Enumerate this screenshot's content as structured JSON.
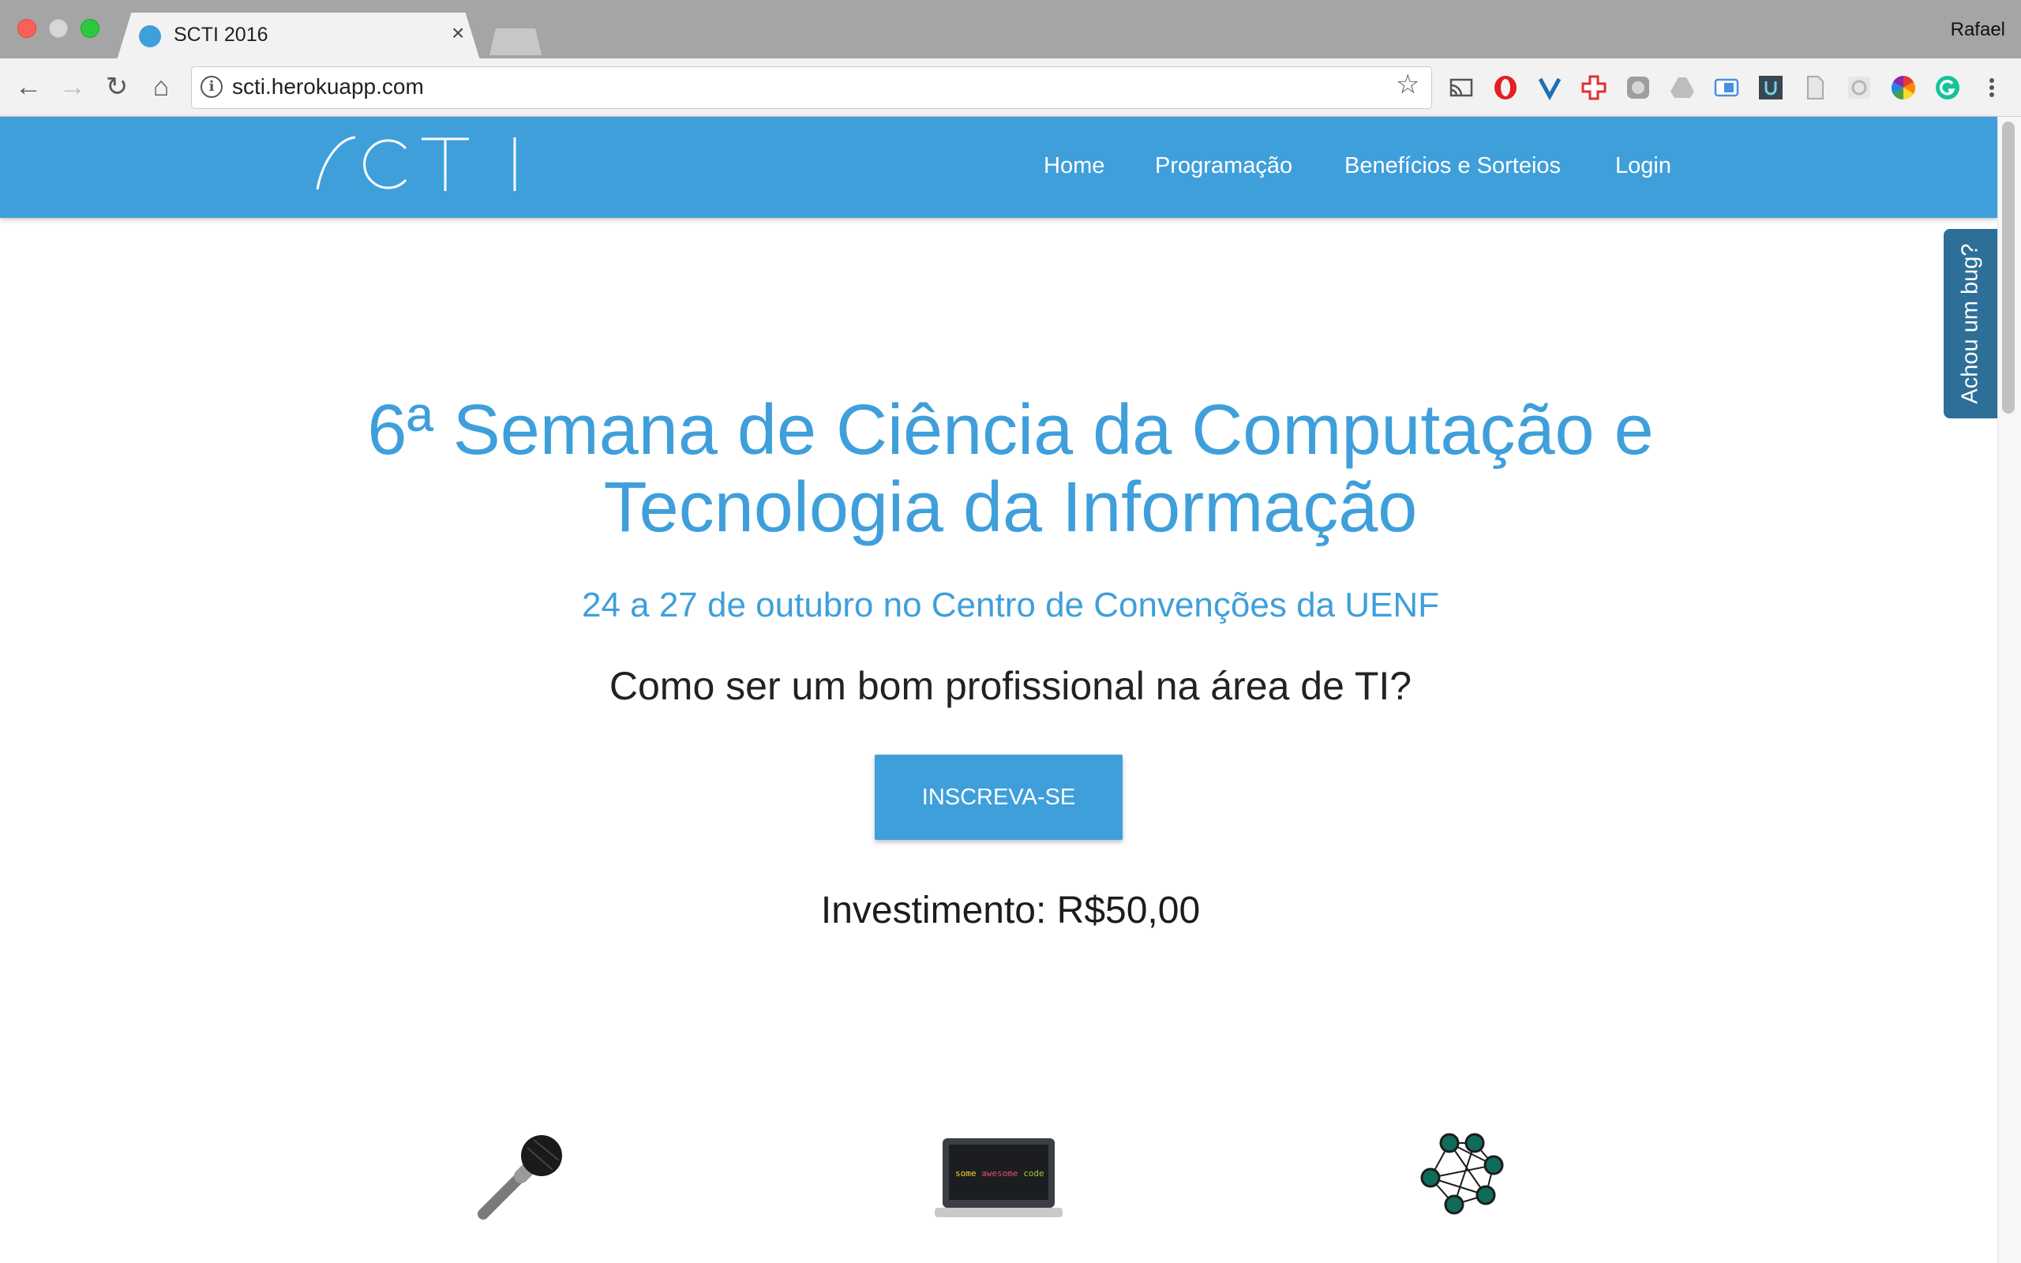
{
  "browser": {
    "tab_title": "SCTI 2016",
    "tab_close": "×",
    "profile_name": "Rafael",
    "url": "scti.herokuapp.com",
    "info_glyph": "i",
    "nav": {
      "back": "←",
      "forward": "→",
      "reload": "↻",
      "home": "⌂"
    },
    "bookmark_glyph": "☆",
    "extensions": [
      "cast-icon",
      "opera-icon",
      "yoast-icon",
      "extension-red-cross-icon",
      "extension-gray-icon",
      "drive-icon",
      "extension-blue-icon",
      "extension-u-icon",
      "extension-doc-icon",
      "extension-gear-icon",
      "color-picker-icon",
      "grammarly-icon",
      "menu-icon"
    ]
  },
  "site": {
    "logo_alt": "SCTI",
    "nav": {
      "home": "Home",
      "programacao": "Programação",
      "beneficios": "Benefícios e Sorteios",
      "login": "Login"
    },
    "bug_tab": "Achou um bug?",
    "hero": {
      "title_line1": "6ª Semana de Ciência da Computação e",
      "title_line2": "Tecnologia da Informação",
      "date": "24 a 27 de outubro no Centro de Convenções da UENF",
      "question": "Como ser um bom profissional na área de TI?",
      "cta": "INSCREVA-SE",
      "price": "Investimento: R$50,00"
    },
    "features": [
      {
        "icon": "microphone-icon"
      },
      {
        "icon": "laptop-icon",
        "screen_text": [
          "some",
          "awesome",
          "code"
        ]
      },
      {
        "icon": "network-icon"
      }
    ]
  },
  "colors": {
    "primary": "#3f9fdb",
    "bug_tab": "#2d6f98",
    "text_dark": "#222222"
  }
}
